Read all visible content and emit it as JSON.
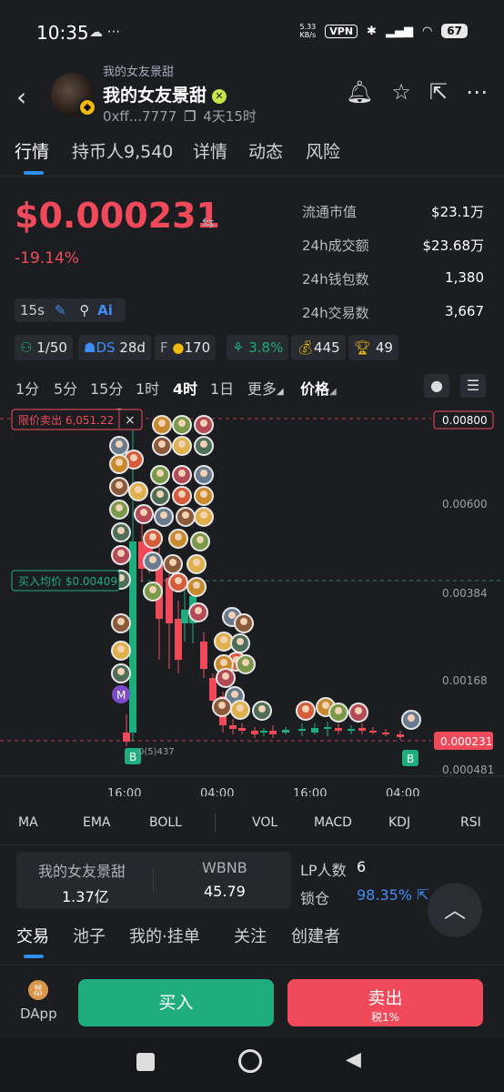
{
  "status_bar": {
    "time": "10:35",
    "notif": "☁ ···",
    "net_speed": "5.33\nKB/s",
    "vpn": "VPN",
    "battery": "67"
  },
  "header": {
    "symbol": "我的女友景甜",
    "name": "我的女友景甜",
    "address": "0xff...7777",
    "age": "4天15时"
  },
  "tabs": [
    {
      "label": "行情",
      "active": true
    },
    {
      "label": "持币人9,540"
    },
    {
      "label": "详情"
    },
    {
      "label": "动态"
    },
    {
      "label": "风险"
    }
  ],
  "price": {
    "value": "$0.000231",
    "change": "-19.14%"
  },
  "stats": [
    {
      "label": "流通市值",
      "value": "$23.1万"
    },
    {
      "label": "24h成交额",
      "value": "$23.68万"
    },
    {
      "label": "24h钱包数",
      "value": "1,380"
    },
    {
      "label": "24h交易数",
      "value": "3,667"
    }
  ],
  "tools": {
    "interval_chip": "15s",
    "ai": "Ai"
  },
  "metrics": [
    {
      "icon": "user-check-icon",
      "text": "1/50"
    },
    {
      "icon": "ds-icon",
      "text": "DS",
      "extra": "28d"
    },
    {
      "icon": "f-icon",
      "text": "F",
      "extra": "170"
    },
    {
      "icon": "percent-icon",
      "text": "3.8%"
    },
    {
      "icon": "money-bag-icon",
      "text": "445"
    },
    {
      "icon": "trophy-icon",
      "text": "49"
    }
  ],
  "intervals": [
    "1分",
    "5分",
    "15分",
    "1时",
    "4时",
    "1日",
    "更多",
    "价格"
  ],
  "active_interval": "4时",
  "chart": {
    "limit_sell_label": "限价卖出 6,051.22",
    "avg_buy_label": "买入均价 $0.00409",
    "y_labels": [
      "0.00800",
      "0.00600",
      "0.00384",
      "0.00168",
      "0.000231",
      "0.000481"
    ],
    "x_labels": [
      "16:00",
      "04:00",
      "16:00",
      "04:00"
    ],
    "low_label": "0(5)437",
    "buy_marker": "B",
    "m_marker": "M"
  },
  "chart_data": {
    "type": "candlestick",
    "y_axis_ticks": [
      "0.00800",
      "0.00600",
      "0.00384",
      "0.00168",
      "0.000481"
    ],
    "current_price": "0.000231",
    "x_ticks": [
      "16:00",
      "04:00",
      "16:00",
      "04:00"
    ],
    "candles_colors": {
      "up": "#1fad7d",
      "down": "#f04a5a"
    }
  },
  "indicators": [
    "MA",
    "EMA",
    "BOLL",
    "VOL",
    "MACD",
    "KDJ",
    "RSI"
  ],
  "liquidity": {
    "token_name": "我的女友景甜",
    "token_amount": "1.37亿",
    "pair_name": "WBNB",
    "pair_amount": "45.79",
    "lp_label": "LP人数",
    "lp_count": "6",
    "lock_label": "锁仓",
    "lock_value": "98.35%"
  },
  "bottom_tabs": [
    "交易",
    "池子",
    "我的·挂单",
    "关注",
    "创建者"
  ],
  "bottom_nav": {
    "dapp": "DApp",
    "buy": "买入",
    "sell": "卖出",
    "tax": "税1%"
  },
  "colors": {
    "red": "#f04a5a",
    "green": "#1fad7d",
    "blue": "#2f8cf0",
    "bg": "#1b1d21"
  }
}
